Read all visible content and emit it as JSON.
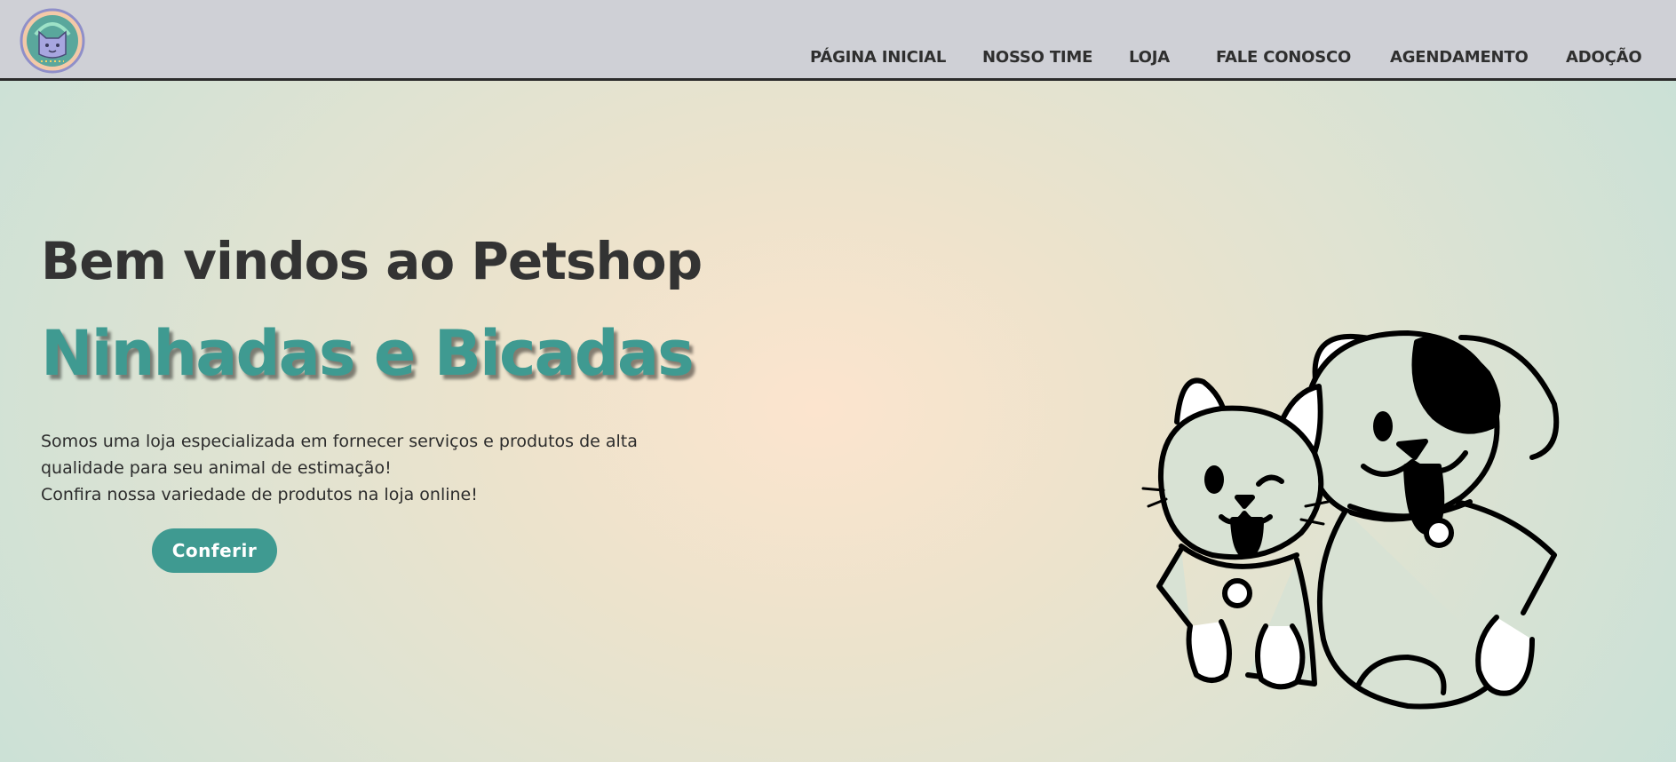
{
  "header": {
    "logo_icon": "cat-logo-icon",
    "nav": [
      {
        "label": "PÁGINA INICIAL"
      },
      {
        "label": "NOSSO TIME"
      },
      {
        "label": "LOJA"
      },
      {
        "label": "FALE CONOSCO"
      },
      {
        "label": "AGENDAMENTO"
      },
      {
        "label": "ADOÇÃO"
      }
    ]
  },
  "hero": {
    "title": "Bem vindos ao Petshop",
    "brand": "Ninhadas e Bicadas",
    "description_lines": [
      "Somos uma loja especializada em fornecer serviços e produtos de alta",
      "qualidade para seu animal de estimação!",
      "Confira nossa variedade de produtos na loja online!"
    ],
    "cta_label": "Conferir",
    "illustration_icon": "cat-and-dog-illustration"
  },
  "colors": {
    "header_bg": "#cfd0d6",
    "accent": "#3f9a91",
    "text_dark": "#333333"
  }
}
